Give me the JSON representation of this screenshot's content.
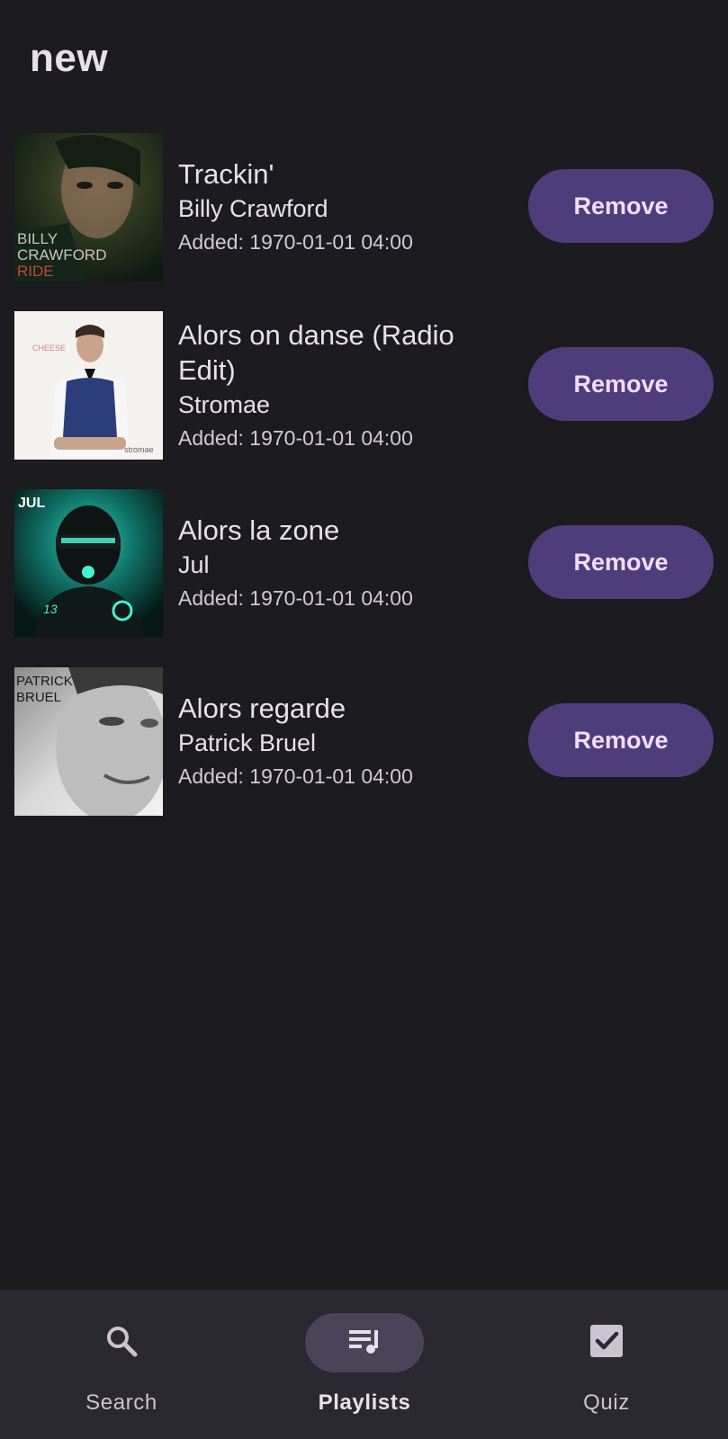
{
  "playlist": {
    "title": "new"
  },
  "tracks": [
    {
      "title": "Trackin'",
      "artist": "Billy Crawford",
      "added": "Added: 1970-01-01 04:00",
      "cover_text": [
        "BILLY",
        "CRAWFORD",
        "RIDE"
      ],
      "remove_label": "Remove"
    },
    {
      "title": "Alors on danse (Radio Edit)",
      "artist": "Stromae",
      "added": "Added: 1970-01-01 04:00",
      "cover_text": [
        "CHEESE",
        "stromae"
      ],
      "remove_label": "Remove"
    },
    {
      "title": "Alors la zone",
      "artist": "Jul",
      "added": "Added: 1970-01-01 04:00",
      "cover_text": [
        "JUL",
        "13"
      ],
      "remove_label": "Remove"
    },
    {
      "title": "Alors regarde",
      "artist": "Patrick Bruel",
      "added": "Added: 1970-01-01 04:00",
      "cover_text": [
        "PATRICK",
        "BRUEL"
      ],
      "remove_label": "Remove"
    }
  ],
  "bottom_nav": {
    "items": [
      {
        "label": "Search",
        "icon": "search-icon",
        "active": false
      },
      {
        "label": "Playlists",
        "icon": "playlist-icon",
        "active": true
      },
      {
        "label": "Quiz",
        "icon": "checkbox-icon",
        "active": false
      }
    ]
  },
  "colors": {
    "background": "#1c1b20",
    "button": "#4f3d7b",
    "button_text": "#f2dcff",
    "nav_background": "#2a2831",
    "nav_active_pill": "#4a4458"
  }
}
